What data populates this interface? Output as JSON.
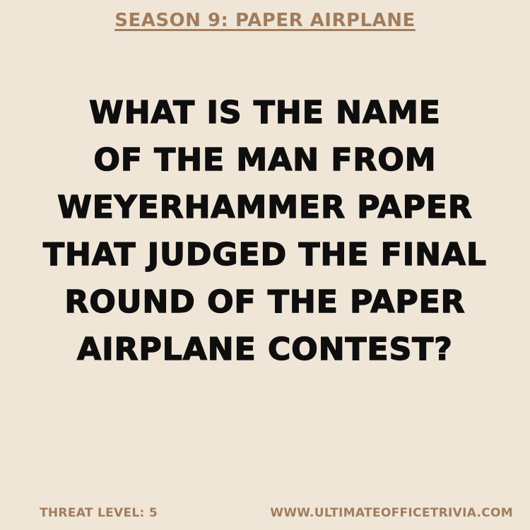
{
  "header": {
    "episode_label": "Season 9: Paper Airplane"
  },
  "question": {
    "lines": [
      "What is the name",
      "of the man from",
      "Weyerhammer paper",
      "that judged the final",
      "round of the paper",
      "airplane contest?"
    ]
  },
  "footer": {
    "threat_level": "Threat Level: 5",
    "website": "www.ultimateofficetrivia.com"
  },
  "colors": {
    "background": "#f0e6d8",
    "accent": "#a17d5c",
    "text": "#0e0e0e"
  }
}
